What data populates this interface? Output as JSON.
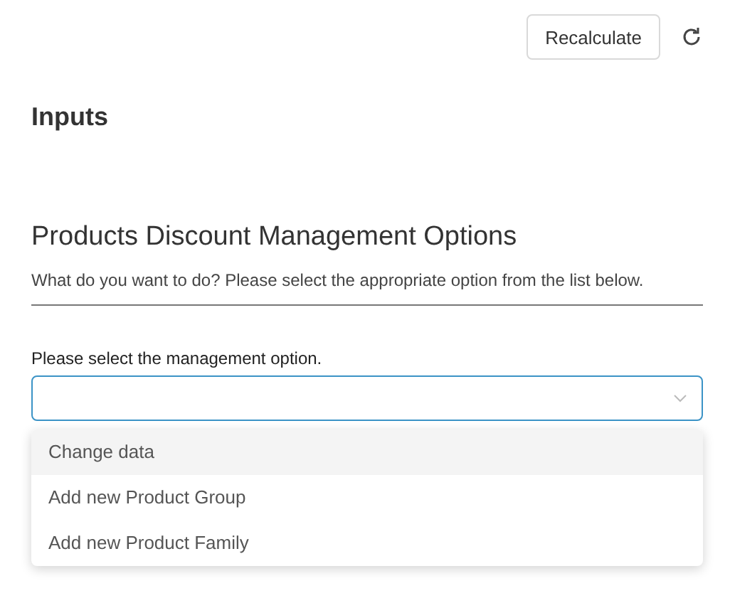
{
  "toolbar": {
    "recalculate_button": "Recalculate"
  },
  "inputs_heading": "Inputs",
  "section": {
    "title": "Products Discount Management Options",
    "description": "What do you want to do? Please select the appropriate option from the list below."
  },
  "select": {
    "label": "Please select the management option.",
    "expanded": true,
    "options": [
      {
        "label": "Change data",
        "highlighted": true
      },
      {
        "label": "Add new Product Group",
        "highlighted": false
      },
      {
        "label": "Add new Product Family",
        "highlighted": false
      }
    ]
  }
}
